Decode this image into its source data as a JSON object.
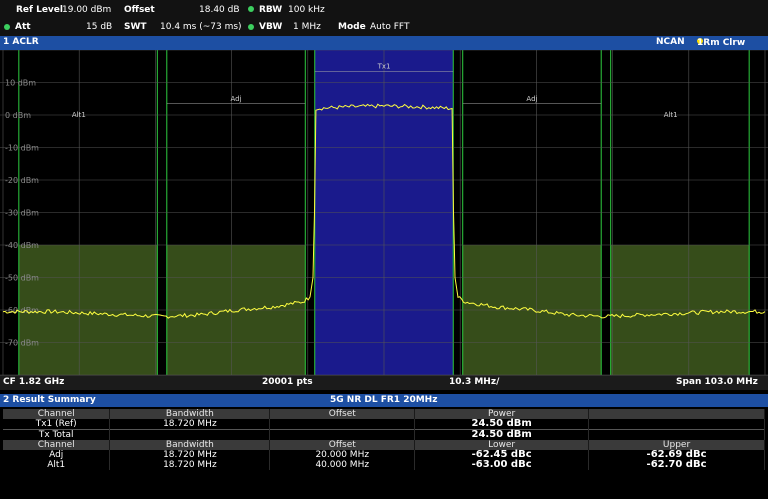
{
  "header": {
    "ref_level_label": "Ref Level",
    "ref_level_value": "19.00 dBm",
    "offset_label": "Offset",
    "offset_value": "18.40 dB",
    "rbw_label": "RBW",
    "rbw_value": "100 kHz",
    "att_label": "Att",
    "att_value": "15 dB",
    "swt_label": "SWT",
    "swt_value": "10.4 ms (~73 ms)",
    "vbw_label": "VBW",
    "vbw_value": "1 MHz",
    "mode_label": "Mode",
    "mode_value": "Auto FFT"
  },
  "window1": {
    "title": "1 ACLR",
    "ncan": "NCAN",
    "trace": "1Rm Clrw"
  },
  "colors": {
    "title_bar": "#1d4fa3",
    "trace": "#ffff40",
    "tx_band": "#1a1a8c",
    "adj_band": "#3f5a1f",
    "green_line": "#2ecc40"
  },
  "chart_data": {
    "type": "line",
    "ylabels": [
      "10 dBm",
      "0 dBm",
      "-10 dBm",
      "-20 dBm",
      "-30 dBm",
      "-40 dBm",
      "-50 dBm",
      "-60 dBm",
      "-70 dBm"
    ],
    "channel_labels": [
      "Tx1",
      "Adj",
      "Adj",
      "Alt1",
      "Alt1"
    ],
    "x_range_mhz": [
      -51.5,
      51.5
    ],
    "y_range_dbm": [
      -80,
      20
    ],
    "channels": [
      {
        "name": "Alt1",
        "center_mhz": -40.0,
        "bw_mhz": 18.72
      },
      {
        "name": "Adj",
        "center_mhz": -20.0,
        "bw_mhz": 18.72
      },
      {
        "name": "Tx1",
        "center_mhz": 0.0,
        "bw_mhz": 18.72
      },
      {
        "name": "Adj",
        "center_mhz": 20.0,
        "bw_mhz": 18.72
      },
      {
        "name": "Alt1",
        "center_mhz": 40.0,
        "bw_mhz": 18.72
      }
    ],
    "trace_dbm": [
      [
        -51.5,
        -60.5
      ],
      [
        -45,
        -60.5
      ],
      [
        -40,
        -61
      ],
      [
        -35,
        -61.5
      ],
      [
        -30,
        -62
      ],
      [
        -25,
        -61.5
      ],
      [
        -20,
        -60
      ],
      [
        -15,
        -59
      ],
      [
        -11,
        -57.5
      ],
      [
        -10,
        -56
      ],
      [
        -9.6,
        -50
      ],
      [
        -9.4,
        -30
      ],
      [
        -9.2,
        2
      ],
      [
        -5,
        2.5
      ],
      [
        0,
        2.8
      ],
      [
        5,
        2.5
      ],
      [
        9.2,
        2
      ],
      [
        9.4,
        -30
      ],
      [
        9.6,
        -50
      ],
      [
        10,
        -56
      ],
      [
        11,
        -57.5
      ],
      [
        15,
        -59
      ],
      [
        20,
        -60
      ],
      [
        25,
        -61.5
      ],
      [
        30,
        -62
      ],
      [
        35,
        -61.5
      ],
      [
        40,
        -61
      ],
      [
        45,
        -60.5
      ],
      [
        51.5,
        -60.5
      ]
    ]
  },
  "footer": {
    "cf": "CF 1.82 GHz",
    "pts": "20001 pts",
    "div": "10.3 MHz/",
    "span": "Span 103.0 MHz"
  },
  "summary": {
    "title": "2 Result Summary",
    "standard": "5G NR DL FR1 20MHz",
    "head1": [
      "Channel",
      "Bandwidth",
      "Offset",
      "Power"
    ],
    "row_tx1": [
      "Tx1 (Ref)",
      "18.720 MHz",
      "",
      "24.50 dBm"
    ],
    "row_total": [
      "Tx Total",
      "",
      "",
      "24.50 dBm"
    ],
    "head2": [
      "Channel",
      "Bandwidth",
      "Offset",
      "Lower",
      "Upper"
    ],
    "row_adj": [
      "Adj",
      "18.720 MHz",
      "20.000 MHz",
      "-62.45 dBc",
      "-62.69 dBc"
    ],
    "row_alt1": [
      "Alt1",
      "18.720 MHz",
      "40.000 MHz",
      "-63.00 dBc",
      "-62.70 dBc"
    ]
  }
}
